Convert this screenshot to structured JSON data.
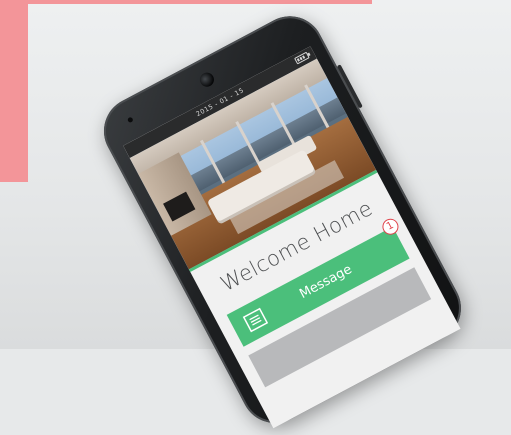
{
  "status_bar": {
    "date": "2015 - 01 - 15"
  },
  "screen": {
    "title": "Welcome Home",
    "message_button": {
      "label": "Message",
      "badge": "1"
    }
  },
  "colors": {
    "accent_green": "#4bbf7b",
    "badge_red": "#e0434b",
    "pink_frame": "#f39599"
  },
  "icons": {
    "message": "message-list-icon",
    "battery": "battery-icon"
  }
}
